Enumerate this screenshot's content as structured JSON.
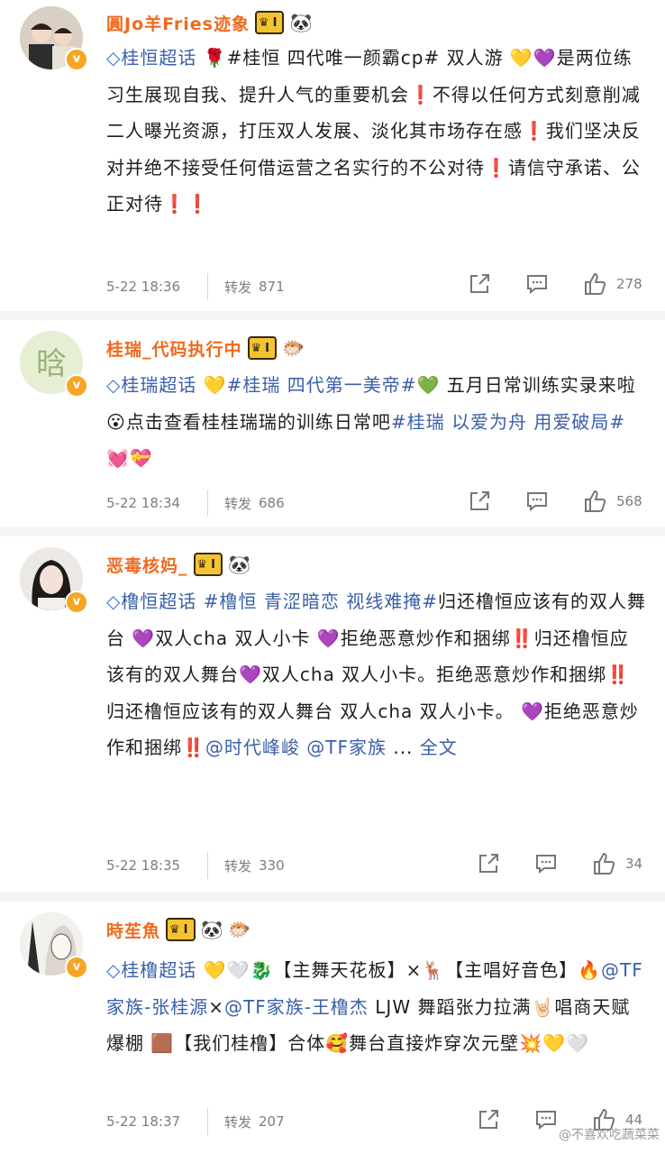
{
  "posts": [
    {
      "username": "圓Jo羊Fries迹象",
      "level": "I",
      "badges": [
        "panda-emoji"
      ],
      "body": [
        {
          "t": "diamond",
          "v": "◇"
        },
        {
          "t": "tag",
          "v": "桂恒超话"
        },
        {
          "t": "txt",
          "v": " 🌹#桂恒 四代唯一颜霸cp# 双人游 💛💜是两位练习生展现自我、提升人气的重要机会❗不得以任何方式刻意削减二人曝光资源，打压双人发展、淡化其市场存在感❗我们坚决反对并绝不接受任何借运营之名实行的不公对待❗请信守承诺、公正对待❗❗"
        }
      ],
      "time": "5-22 18:36",
      "repost_label": "转发",
      "repost_count": "871",
      "like_count": "278"
    },
    {
      "username": "桂瑞_代码执行中",
      "level": "I",
      "badges": [
        "puffer-fish-emoji"
      ],
      "body": [
        {
          "t": "diamond",
          "v": "◇"
        },
        {
          "t": "tag",
          "v": "桂瑞超话"
        },
        {
          "t": "txt",
          "v": " 💛"
        },
        {
          "t": "tag",
          "v": "#桂瑞 四代第一美帝#"
        },
        {
          "t": "txt",
          "v": "💚 五月日常训练实录来啦😮点击查看桂桂瑞瑞的训练日常吧"
        },
        {
          "t": "tag",
          "v": "#桂瑞 以爱为舟 用爱破局#"
        },
        {
          "t": "txt",
          "v": "💓💝"
        }
      ],
      "time": "5-22 18:34",
      "repost_label": "转发",
      "repost_count": "686",
      "like_count": "568"
    },
    {
      "username": "恶毒核妈_",
      "level": "I",
      "badges": [
        "panda-emoji"
      ],
      "body": [
        {
          "t": "diamond",
          "v": "◇"
        },
        {
          "t": "tag",
          "v": "橹恒超话 #橹恒 青涩暗恋 视线难掩#"
        },
        {
          "t": "txt",
          "v": "归还橹恒应该有的双人舞台 💜双人cha 双人小卡 💜拒绝恶意炒作和捆绑‼️归还橹恒应该有的双人舞台💜双人cha 双人小卡。拒绝恶意炒作和捆绑‼️归还橹恒应该有的双人舞台 双人cha 双人小卡。 💜拒绝恶意炒作和捆绑‼️"
        },
        {
          "t": "tag",
          "v": "@时代峰峻 @TF家族"
        },
        {
          "t": "txt",
          "v": " ... "
        },
        {
          "t": "more",
          "v": "全文"
        }
      ],
      "time": "5-22 18:35",
      "repost_label": "转发",
      "repost_count": "330",
      "like_count": "34"
    },
    {
      "username": "時苼魚",
      "level": "I",
      "badges": [
        "panda-emoji",
        "puffer-fish-emoji"
      ],
      "body": [
        {
          "t": "diamond",
          "v": "◇"
        },
        {
          "t": "tag",
          "v": "桂橹超话"
        },
        {
          "t": "txt",
          "v": " 💛🤍🐉【主舞天花板】×🦌【主唱好音色】🔥"
        },
        {
          "t": "tag",
          "v": "@TF家族-张桂源"
        },
        {
          "t": "txt",
          "v": "×"
        },
        {
          "t": "tag",
          "v": "@TF家族-王橹杰"
        },
        {
          "t": "txt",
          "v": " LJW 舞蹈张力拉满🤘🏻唱商天赋爆棚 🟫【我们桂橹】合体🥰舞台直接炸穿次元壁💥💛🤍"
        }
      ],
      "time": "5-22 18:37",
      "repost_label": "转发",
      "repost_count": "207",
      "like_count": "44"
    }
  ],
  "watermark": "@不喜欢吃蔬菜菜"
}
